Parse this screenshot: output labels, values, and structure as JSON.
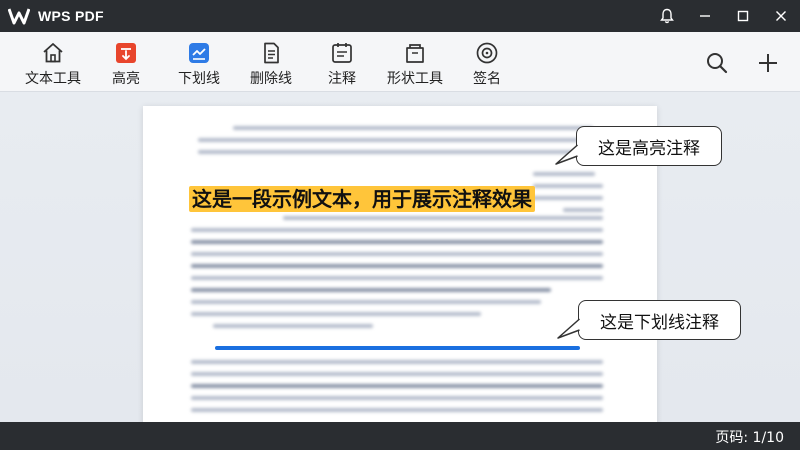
{
  "app": {
    "title": "WPS PDF"
  },
  "toolbar": {
    "tools": [
      {
        "label": "文本工具",
        "icon": "home-icon"
      },
      {
        "label": "高亮",
        "icon": "highlight-icon"
      },
      {
        "label": "下划线",
        "icon": "underline-icon"
      },
      {
        "label": "删除线",
        "icon": "strikethrough-icon"
      },
      {
        "label": "注释",
        "icon": "comment-icon"
      },
      {
        "label": "形状工具",
        "icon": "shape-icon"
      },
      {
        "label": "签名",
        "icon": "signature-icon"
      }
    ]
  },
  "document": {
    "highlighted_text": "这是一段示例文本，用于展示注释效果"
  },
  "callouts": {
    "highlight": "这是高亮注释",
    "underline": "这是下划线注释"
  },
  "status": {
    "page_indicator": "页码: 1/10"
  },
  "colors": {
    "highlight": "#ffc53a",
    "underline": "#1a6fe0",
    "highlight_icon": "#e8452c",
    "underline_icon": "#2e7be6"
  }
}
